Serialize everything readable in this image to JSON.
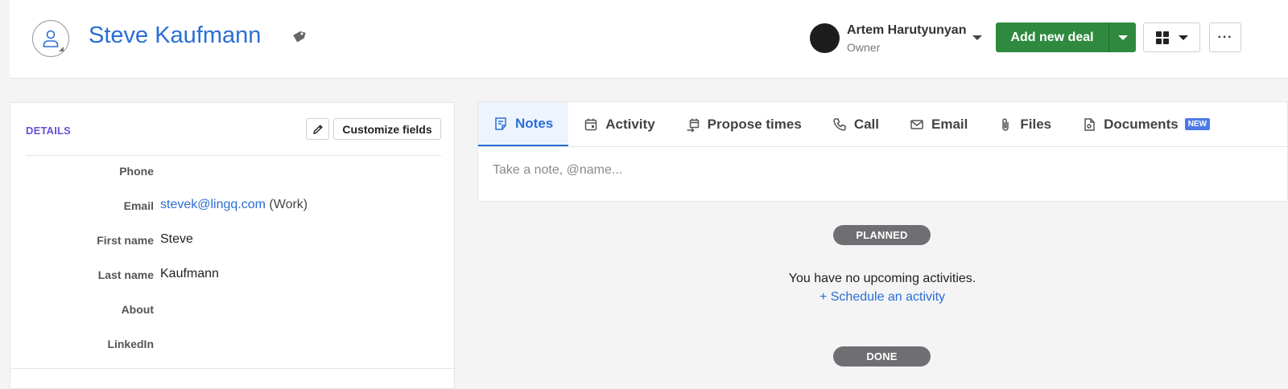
{
  "header": {
    "person_name": "Steve Kaufmann",
    "owner_name": "Artem Harutyunyan",
    "owner_role": "Owner",
    "add_deal_label": "Add new deal",
    "more_label": "···"
  },
  "details": {
    "title": "DETAILS",
    "customize_label": "Customize fields",
    "fields": [
      {
        "label": "Phone",
        "value": ""
      },
      {
        "label": "Email",
        "value": "stevek@lingq.com",
        "suffix": "(Work)"
      },
      {
        "label": "First name",
        "value": "Steve"
      },
      {
        "label": "Last name",
        "value": "Kaufmann"
      },
      {
        "label": "About",
        "value": ""
      },
      {
        "label": "LinkedIn",
        "value": ""
      }
    ]
  },
  "tabs": [
    {
      "label": "Notes",
      "icon": "note-icon"
    },
    {
      "label": "Activity",
      "icon": "calendar-icon"
    },
    {
      "label": "Propose times",
      "icon": "propose-times-icon"
    },
    {
      "label": "Call",
      "icon": "phone-icon"
    },
    {
      "label": "Email",
      "icon": "envelope-icon"
    },
    {
      "label": "Files",
      "icon": "paperclip-icon"
    },
    {
      "label": "Documents",
      "icon": "document-icon",
      "badge": "NEW"
    }
  ],
  "note": {
    "placeholder": "Take a note, @name..."
  },
  "timeline": {
    "planned_label": "PLANNED",
    "empty_text": "You have no upcoming activities.",
    "schedule_link": "+ Schedule an activity",
    "done_label": "DONE"
  },
  "colors": {
    "accent": "#2a6ed6",
    "primary_green": "#2f8a3f",
    "details_title": "#6a4fd6",
    "pill": "#6f6f73",
    "badge": "#4d79e8"
  }
}
